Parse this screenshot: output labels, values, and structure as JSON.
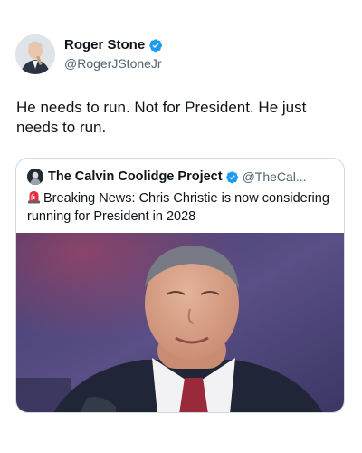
{
  "tweet": {
    "author": {
      "display_name": "Roger Stone",
      "handle": "@RogerJStoneJr",
      "verified_icon": "verified-badge-icon",
      "avatar": "avatar"
    },
    "text": "He needs to run. Not for President. He just needs to run."
  },
  "quoted_tweet": {
    "author": {
      "display_name": "The Calvin Coolidge Project",
      "handle": "@TheCal...",
      "verified_icon": "verified-badge-icon"
    },
    "emoji_icon": "siren-icon",
    "text": "Breaking News: Chris Christie is now considering running for President in 2028",
    "media": "photo"
  },
  "colors": {
    "verified": "#1d9bf0",
    "secondary_text": "#536471",
    "border": "#cfd9de",
    "photo_background": "#4a4a78"
  }
}
